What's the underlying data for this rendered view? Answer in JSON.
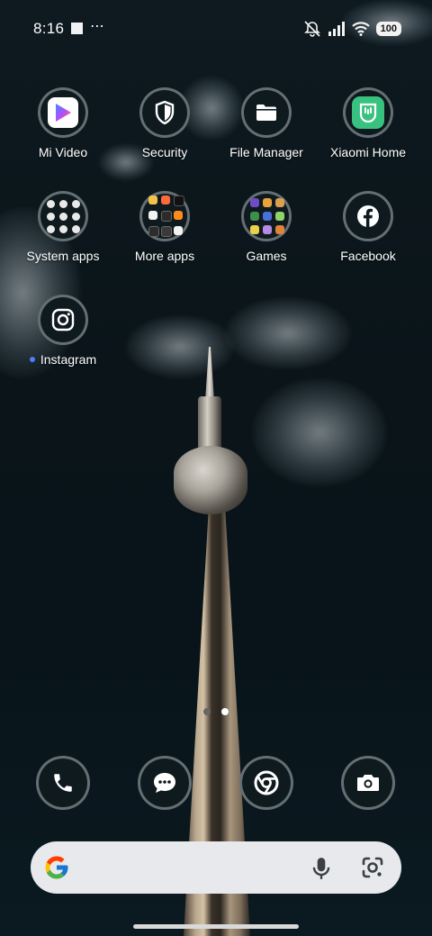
{
  "status_bar": {
    "time": "8:16",
    "overflow": "⋯",
    "battery": "100",
    "icons": [
      "notification-square-icon",
      "mute-bell-icon",
      "signal-icon",
      "wifi-icon",
      "battery-icon"
    ]
  },
  "apps": [
    {
      "label": "Mi Video",
      "icon": "mi-video-play-icon"
    },
    {
      "label": "Security",
      "icon": "shield-icon"
    },
    {
      "label": "File Manager",
      "icon": "folder-icon"
    },
    {
      "label": "Xiaomi Home",
      "icon": "xiaomi-home-icon"
    },
    {
      "label": "System apps",
      "icon": "folder-system-apps-icon"
    },
    {
      "label": "More apps",
      "icon": "folder-more-apps-icon"
    },
    {
      "label": "Games",
      "icon": "folder-games-icon"
    },
    {
      "label": "Facebook",
      "icon": "facebook-icon"
    },
    {
      "label": "Instagram",
      "icon": "instagram-icon",
      "new_indicator": true
    }
  ],
  "pager": {
    "pages": 2,
    "current": 2
  },
  "dock": [
    {
      "icon": "phone-icon"
    },
    {
      "icon": "messages-icon"
    },
    {
      "icon": "chrome-icon"
    },
    {
      "icon": "camera-icon"
    }
  ],
  "search_bar": {
    "icons": [
      "google-g-icon",
      "microphone-icon",
      "google-lens-icon"
    ]
  },
  "colors": {
    "ring": "#82898d",
    "new_dot": "#4f7cff",
    "xiaomi_green": "#39c27f"
  }
}
